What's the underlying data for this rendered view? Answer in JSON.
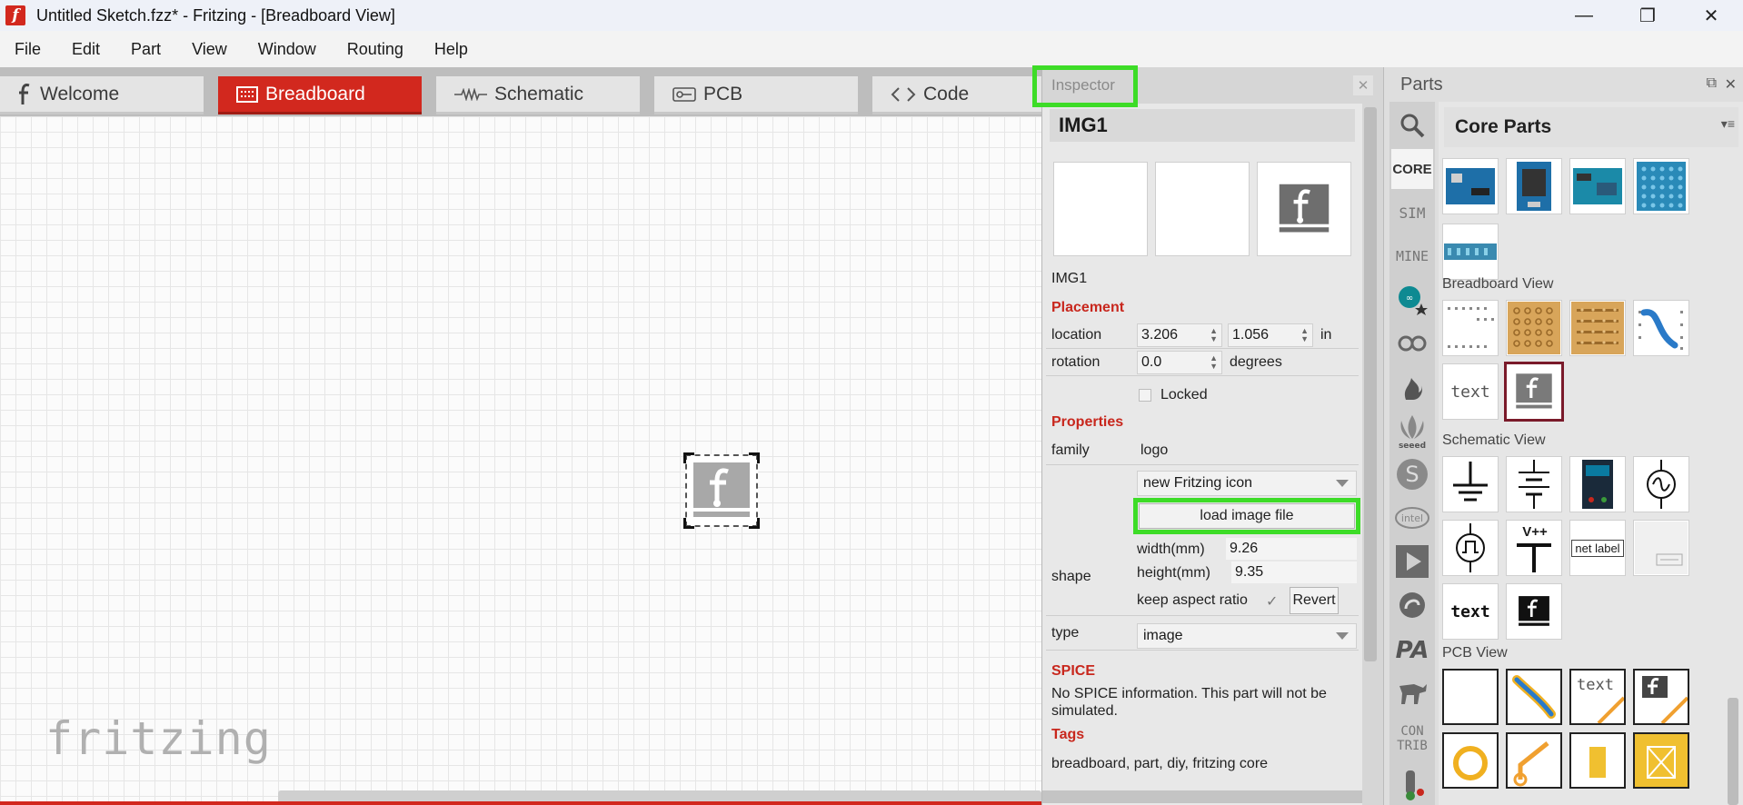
{
  "window": {
    "title": "Untitled Sketch.fzz* - Fritzing - [Breadboard View]",
    "app_icon_glyph": "f",
    "minimize": "—",
    "restore": "❐",
    "close": "✕"
  },
  "menu": [
    "File",
    "Edit",
    "Part",
    "View",
    "Window",
    "Routing",
    "Help"
  ],
  "tabs": [
    {
      "label": "Welcome",
      "active": false
    },
    {
      "label": "Breadboard",
      "active": true
    },
    {
      "label": "Schematic",
      "active": false
    },
    {
      "label": "PCB",
      "active": false
    },
    {
      "label": "Code",
      "active": false
    }
  ],
  "canvas": {
    "watermark": "fritzing"
  },
  "inspector": {
    "title": "Inspector",
    "close": "✕",
    "part_title": "IMG1",
    "part_label": "IMG1",
    "placement": {
      "heading": "Placement",
      "location_label": "location",
      "location_x": "3.206",
      "location_y": "1.056",
      "location_unit": "in",
      "rotation_label": "rotation",
      "rotation": "0.0",
      "rotation_unit": "degrees",
      "locked_label": "Locked"
    },
    "properties": {
      "heading": "Properties",
      "family_label": "family",
      "family_value": "logo",
      "shape_dropdown": "new Fritzing icon",
      "load_button": "load image file",
      "shape_label": "shape",
      "width_label": "width(mm)",
      "width_value": "9.26",
      "height_label": "height(mm)",
      "height_value": "9.35",
      "aspect_label": "keep aspect ratio",
      "aspect_check": "✓",
      "revert_button": "Revert",
      "type_label": "type",
      "type_value": "image"
    },
    "spice": {
      "heading": "SPICE",
      "text": "No SPICE information. This part will not be simulated."
    },
    "tags": {
      "heading": "Tags",
      "text": "breadboard, part, diy, fritzing core"
    }
  },
  "parts": {
    "title": "Parts",
    "float_ctrl": "⧉",
    "close_ctrl": "✕",
    "bin_title": "Core Parts",
    "menu_ctrl": "▾≡",
    "bins": [
      "CORE",
      "SIM",
      "MINE",
      "CON TRIB"
    ],
    "sections": {
      "breadboard": "Breadboard View",
      "schematic": "Schematic View",
      "pcb": "PCB View"
    },
    "tile_texts": {
      "text": "text",
      "netlabel": "net label",
      "vpp": "V++"
    }
  },
  "colors": {
    "accent": "#d2281e",
    "highlight": "#3ddc27",
    "section_red": "#c8271d"
  }
}
